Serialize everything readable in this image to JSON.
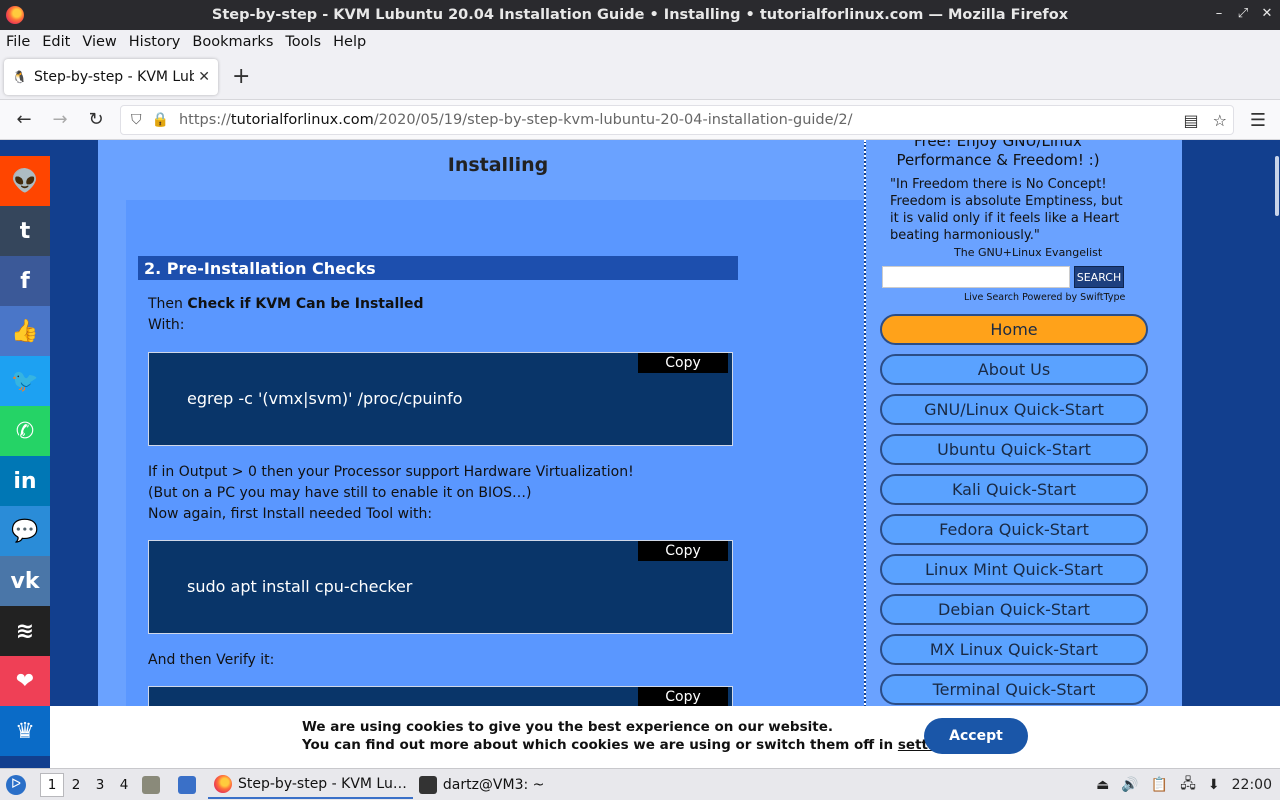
{
  "window": {
    "title": "Step-by-step - KVM Lubuntu 20.04 Installation Guide • Installing • tutorialforlinux.com — Mozilla Firefox",
    "controls": {
      "minimize": "–",
      "maximize": "⤢",
      "close": "✕"
    }
  },
  "menu": [
    "File",
    "Edit",
    "View",
    "History",
    "Bookmarks",
    "Tools",
    "Help"
  ],
  "tab": {
    "title": "Step-by-step - KVM Lubun",
    "close": "✕",
    "new_tab": "+"
  },
  "nav": {
    "back": "←",
    "forward": "→",
    "reload": "↻",
    "url_prefix": "https://",
    "url_domain": "tutorialforlinux.com",
    "url_path": "/2020/05/19/step-by-step-kvm-lubuntu-20-04-installation-guide/2/"
  },
  "page": {
    "heading": "Installing",
    "section_title": "2. Pre-Installation Checks",
    "text_then": "Then ",
    "text_check": "Check if KVM Can be Installed",
    "text_with": "With:",
    "code1": "egrep -c '(vmx|svm)' /proc/cpuinfo",
    "copy_label": "Copy",
    "text_output1": "If in Output > 0 then your Processor support Hardware Virtualization!",
    "text_output2": "(But on a PC you may have still to enable it on BIOS…)",
    "text_output3": "Now again, first Install needed Tool with:",
    "code2": "sudo apt install cpu-checker",
    "text_verify": "And then Verify it:"
  },
  "sidebar": {
    "tagline1": "Free! Enjoy GNU/Linux",
    "tagline2": "Performance & Freedom! :)",
    "quote": "\"In Freedom there is No Concept! Freedom is absolute Emptiness, but it is valid only if it feels like a Heart beating harmoniously.\"",
    "author": "The GNU+Linux Evangelist",
    "search_button": "SEARCH",
    "powered": "Live Search Powered by SwiftType",
    "links": [
      "Home",
      "About Us",
      "GNU/Linux Quick-Start",
      "Ubuntu Quick-Start",
      "Kali Quick-Start",
      "Fedora Quick-Start",
      "Linux Mint Quick-Start",
      "Debian Quick-Start",
      "MX Linux Quick-Start",
      "Terminal Quick-Start"
    ]
  },
  "share": [
    {
      "name": "reddit",
      "glyph": "👽",
      "color": "#ff4500"
    },
    {
      "name": "tumblr",
      "glyph": "t",
      "color": "#35465c"
    },
    {
      "name": "facebook",
      "glyph": "f",
      "color": "#3b5998"
    },
    {
      "name": "like",
      "glyph": "👍",
      "color": "#4a76c8"
    },
    {
      "name": "twitter",
      "glyph": "🐦",
      "color": "#1da1f2"
    },
    {
      "name": "whatsapp",
      "glyph": "✆",
      "color": "#25d366"
    },
    {
      "name": "linkedin",
      "glyph": "in",
      "color": "#0077b5"
    },
    {
      "name": "sms",
      "glyph": "💬",
      "color": "#2a8cd8"
    },
    {
      "name": "vk",
      "glyph": "vk",
      "color": "#4a76a8"
    },
    {
      "name": "buffer",
      "glyph": "≋",
      "color": "#222222"
    },
    {
      "name": "pocket",
      "glyph": "❤",
      "color": "#ef4056"
    },
    {
      "name": "sumo",
      "glyph": "♛",
      "color": "#0a6bc7"
    }
  ],
  "cookie": {
    "line1": "We are using cookies to give you the best experience on our website.",
    "line2_pre": "You can find out more about which cookies we are using or switch them off in ",
    "line2_link": "settings",
    "line2_post": ".",
    "accept": "Accept"
  },
  "taskbar": {
    "workspaces": [
      "1",
      "2",
      "3",
      "4"
    ],
    "firefox_label": "Step-by-step - KVM Lu…",
    "terminal_label": "dartz@VM3: ~",
    "clock": "22:00"
  },
  "colors": {
    "accent": "#ffa21a",
    "page_bg": "#123f8e",
    "content_bg": "#6aa2ff"
  }
}
